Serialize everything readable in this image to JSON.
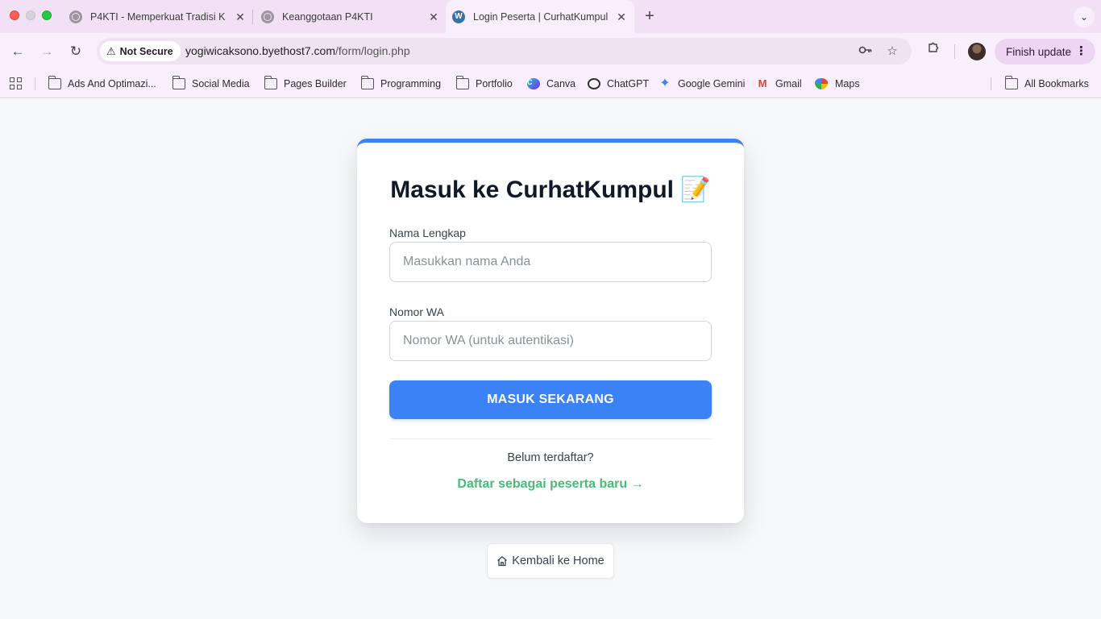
{
  "browser": {
    "tabs": [
      {
        "title": "P4KTI - Memperkuat Tradisi K",
        "favicon": "globe-icon",
        "active": false
      },
      {
        "title": "Keanggotaan P4KTI",
        "favicon": "globe-icon",
        "active": false
      },
      {
        "title": "Login Peserta | CurhatKumpul",
        "favicon": "wordpress-icon",
        "active": true
      }
    ],
    "security_label": "Not Secure",
    "url_host": "yogiwicaksono.byethost7.com",
    "url_path": "/form/login.php",
    "finish_update_label": "Finish update",
    "bookmarks": [
      {
        "label": "Ads And Optimazi...",
        "icon": "folder-icon"
      },
      {
        "label": "Social Media",
        "icon": "folder-icon"
      },
      {
        "label": "Pages Builder",
        "icon": "folder-icon"
      },
      {
        "label": "Programming",
        "icon": "folder-icon"
      },
      {
        "label": "Portfolio",
        "icon": "folder-icon"
      },
      {
        "label": "Canva",
        "icon": "canva-icon"
      },
      {
        "label": "ChatGPT",
        "icon": "chatgpt-icon"
      },
      {
        "label": "Google Gemini",
        "icon": "gemini-icon"
      },
      {
        "label": "Gmail",
        "icon": "gmail-icon"
      },
      {
        "label": "Maps",
        "icon": "maps-icon"
      }
    ],
    "all_bookmarks_label": "All Bookmarks"
  },
  "login": {
    "title": "Masuk ke CurhatKumpul 📝",
    "name_label": "Nama Lengkap",
    "name_placeholder": "Masukkan nama Anda",
    "name_value": "",
    "wa_label": "Nomor WA",
    "wa_placeholder": "Nomor WA (untuk autentikasi)",
    "wa_value": "",
    "submit_label": "MASUK SEKARANG",
    "not_registered_text": "Belum terdaftar?",
    "register_link": "Daftar sebagai peserta baru →"
  },
  "home_button_label": "Kembali ke Home",
  "colors": {
    "accent": "#3b82f6",
    "link_green": "#48bb78",
    "page_bg": "#f7f8fa"
  }
}
